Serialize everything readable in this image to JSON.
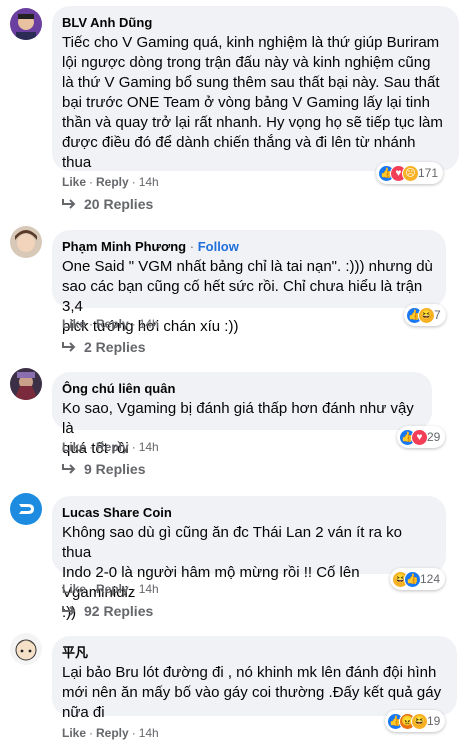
{
  "comments": [
    {
      "name": "BLV Anh Dũng",
      "follow": "",
      "text": "Tiếc cho V Gaming quá, kinh nghiệm là thứ giúp Buriram\nlội ngược dòng trong trận đấu này và kinh nghiệm cũng\nlà thứ V Gaming bổ sung thêm sau thất bại này. Sau thất\nbại trước ONE Team ở vòng bảng V Gaming lấy lại tinh\nthần và quay trở lại rất nhanh. Hy vọng họ sẽ tiếp tục làm\nđược điều đó để dành chiến thắng và đi lên từ nhánh\nthua",
      "like": "Like",
      "reply": "Reply",
      "time": "14h",
      "reactions": [
        "like",
        "love",
        "sad"
      ],
      "reaction_count": "171",
      "replies": "20 Replies"
    },
    {
      "name": "Phạm Minh Phương",
      "follow": "Follow",
      "text": "One Said \" VGM nhất bảng chỉ là tai nạn\". :))) nhưng dù\nsao các bạn cũng cố hết sức rồi. Chỉ chưa hiểu là trận 3,4\npick tướng hơi chán xíu :))",
      "like": "Like",
      "reply": "Reply",
      "time": "14h",
      "reactions": [
        "like",
        "haha"
      ],
      "reaction_count": "7",
      "replies": "2 Replies"
    },
    {
      "name": "Ông chú liên quân",
      "follow": "",
      "text": "Ko sao, Vgaming bị đánh giá thấp hơn đánh như vậy là\nquá tốt rồi",
      "like": "Like",
      "reply": "Reply",
      "time": "14h",
      "reactions": [
        "like",
        "love"
      ],
      "reaction_count": "29",
      "replies": "9 Replies"
    },
    {
      "name": "Lucas Share Coin",
      "follow": "",
      "text": "Không sao dù gì cũng ăn đc Thái Lan 2 ván ít ra ko thua\nIndo 2-0 là người hâm mộ mừng rồi !! Cố lên Vgaminidiz\n:))",
      "like": "Like",
      "reply": "Reply",
      "time": "14h",
      "reactions": [
        "haha",
        "like"
      ],
      "reaction_count": "124",
      "replies": "92 Replies"
    },
    {
      "name": "平凡",
      "follow": "",
      "text": "Lại bảo Bru lót đường đi , nó khinh mk lên đánh đội hình\nmới nên ăn mấy bố vào gáy coi thường .Đấy kết quả gáy\nnữa đi",
      "like": "Like",
      "reply": "Reply",
      "time": "14h",
      "reactions": [
        "like",
        "angry",
        "haha"
      ],
      "reaction_count": "19",
      "replies": ""
    }
  ],
  "colors": {
    "bubble": "#f0f2f5",
    "follow": "#216fdb",
    "meta": "#65676b",
    "like": "#1877f2",
    "love": "#f33e58",
    "haha": "#f7b125",
    "angry": "#e9710f"
  }
}
